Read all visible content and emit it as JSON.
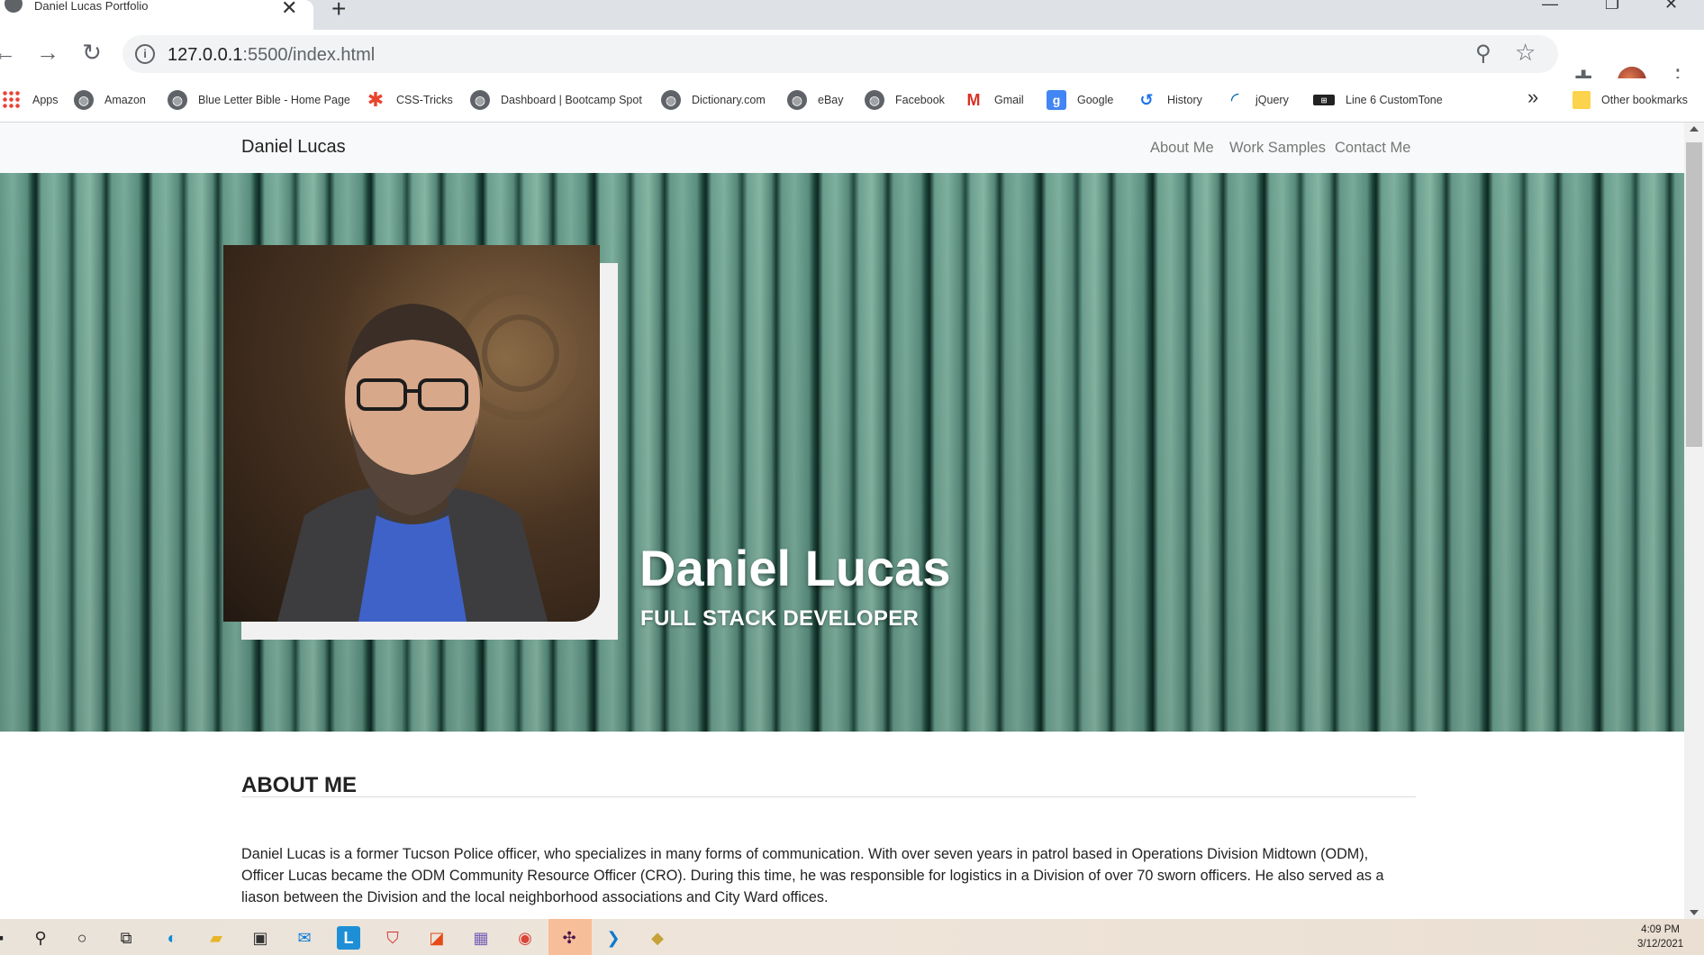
{
  "browser": {
    "tab_title": "Daniel Lucas Portfolio",
    "tab_close": "✕",
    "new_tab": "+",
    "url_host": "127.0.0.1",
    "url_path": ":5500/index.html"
  },
  "bookmarks": [
    {
      "label": "Apps",
      "icon": "apps-icon"
    },
    {
      "label": "Amazon",
      "icon": "globe-icon"
    },
    {
      "label": "Blue Letter Bible - Home Page",
      "icon": "globe-icon"
    },
    {
      "label": "CSS-Tricks",
      "icon": "css-tricks-icon"
    },
    {
      "label": "Dashboard | Bootcamp Spot",
      "icon": "globe-icon"
    },
    {
      "label": "Dictionary.com",
      "icon": "globe-icon"
    },
    {
      "label": "eBay",
      "icon": "globe-icon"
    },
    {
      "label": "Facebook",
      "icon": "globe-icon"
    },
    {
      "label": "Gmail",
      "icon": "gmail-icon"
    },
    {
      "label": "Google",
      "icon": "google-icon"
    },
    {
      "label": "History",
      "icon": "history-icon"
    },
    {
      "label": "jQuery",
      "icon": "jquery-icon"
    },
    {
      "label": "Line 6 CustomTone",
      "icon": "line6-icon"
    },
    {
      "label": "Other bookmarks",
      "icon": "folder-icon"
    }
  ],
  "bookmarks_more": "»",
  "site": {
    "brand": "Daniel Lucas",
    "nav": [
      "About Me",
      "Work Samples",
      "Contact Me"
    ],
    "hero_name": "Daniel Lucas",
    "hero_title": "FULL STACK DEVELOPER",
    "about_heading": "ABOUT ME",
    "about_text": "Daniel Lucas is a former Tucson Police officer, who specializes in many forms of communication. With over seven years in patrol based in Operations Division Midtown (ODM), Officer Lucas became the ODM Community Resource Officer (CRO). During this time, he was responsible for logistics in a Division of over 70 sworn officers. He also served as a liason between the Division and the local neighborhood associations and City Ward offices."
  },
  "taskbar": {
    "time": "4:09 PM",
    "date": "3/12/2021"
  },
  "colors": {
    "hero_green": "#6a9f8e",
    "navbar_bg": "#f8f9fa",
    "nav_link": "#777777"
  }
}
